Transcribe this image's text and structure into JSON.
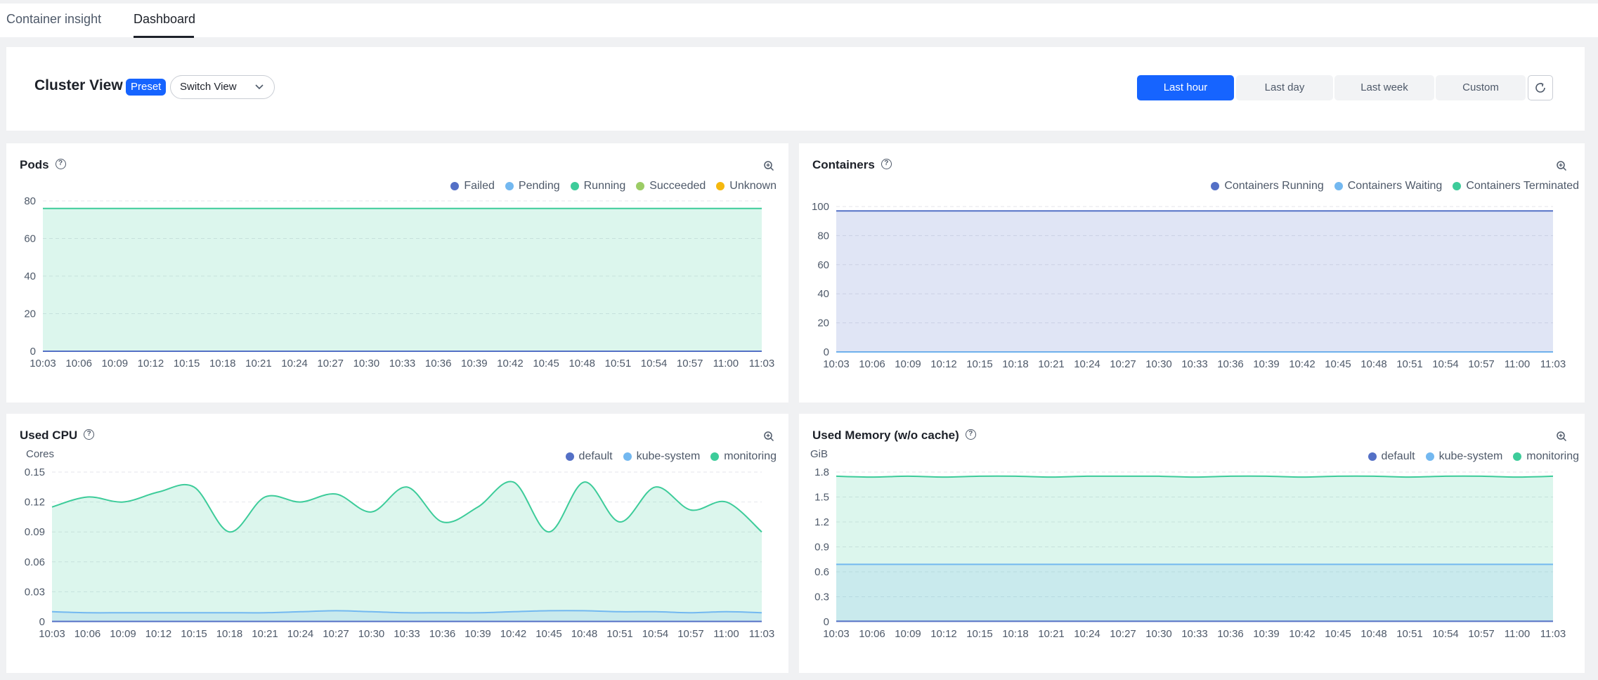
{
  "tabs": [
    {
      "label": "Container insight",
      "active": false
    },
    {
      "label": "Dashboard",
      "active": true
    }
  ],
  "header": {
    "title": "Cluster View",
    "badge": "Preset",
    "switch_view_label": "Switch View",
    "time_ranges": [
      {
        "label": "Last hour",
        "active": true
      },
      {
        "label": "Last day",
        "active": false
      },
      {
        "label": "Last week",
        "active": false
      },
      {
        "label": "Custom",
        "active": false
      }
    ]
  },
  "colors": {
    "accent": "#1664ff",
    "failed_default": "#5470c6",
    "pending_kube": "#73b8f0",
    "running_monitoring": "#3dcc9a",
    "succeeded": "#9ccc65",
    "unknown": "#f5b80e"
  },
  "panels": {
    "pods": {
      "title": "Pods",
      "legend": [
        {
          "name": "Failed",
          "color": "#5470c6"
        },
        {
          "name": "Pending",
          "color": "#73b8f0"
        },
        {
          "name": "Running",
          "color": "#3dcc9a"
        },
        {
          "name": "Succeeded",
          "color": "#9ccc65"
        },
        {
          "name": "Unknown",
          "color": "#f5b80e"
        }
      ]
    },
    "containers": {
      "title": "Containers",
      "legend": [
        {
          "name": "Containers Running",
          "color": "#5470c6"
        },
        {
          "name": "Containers Waiting",
          "color": "#73b8f0"
        },
        {
          "name": "Containers Terminated",
          "color": "#3dcc9a"
        }
      ]
    },
    "cpu": {
      "title": "Used CPU",
      "legend": [
        {
          "name": "default",
          "color": "#5470c6"
        },
        {
          "name": "kube-system",
          "color": "#73b8f0"
        },
        {
          "name": "monitoring",
          "color": "#3dcc9a"
        }
      ]
    },
    "memory": {
      "title": "Used Memory (w/o cache)",
      "legend": [
        {
          "name": "default",
          "color": "#5470c6"
        },
        {
          "name": "kube-system",
          "color": "#73b8f0"
        },
        {
          "name": "monitoring",
          "color": "#3dcc9a"
        }
      ]
    }
  },
  "chart_data": [
    {
      "type": "area",
      "name": "pods",
      "x": [
        "10:03",
        "10:06",
        "10:09",
        "10:12",
        "10:15",
        "10:18",
        "10:21",
        "10:24",
        "10:27",
        "10:30",
        "10:33",
        "10:36",
        "10:39",
        "10:42",
        "10:45",
        "10:48",
        "10:51",
        "10:54",
        "10:57",
        "11:00",
        "11:03"
      ],
      "ylim": [
        0,
        80
      ],
      "yticks": [
        0,
        20,
        40,
        60,
        80
      ],
      "yunit": "",
      "series": [
        {
          "name": "Failed",
          "color": "#5470c6",
          "values": [
            0,
            0,
            0,
            0,
            0,
            0,
            0,
            0,
            0,
            0,
            0,
            0,
            0,
            0,
            0,
            0,
            0,
            0,
            0,
            0,
            0
          ]
        },
        {
          "name": "Pending",
          "color": "#73b8f0",
          "values": [
            0,
            0,
            0,
            0,
            0,
            0,
            0,
            0,
            0,
            0,
            0,
            0,
            0,
            0,
            0,
            0,
            0,
            0,
            0,
            0,
            0
          ]
        },
        {
          "name": "Running",
          "color": "#3dcc9a",
          "values": [
            76,
            76,
            76,
            76,
            76,
            76,
            76,
            76,
            76,
            76,
            76,
            76,
            76,
            76,
            76,
            76,
            76,
            76,
            76,
            76,
            76
          ]
        },
        {
          "name": "Succeeded",
          "color": "#9ccc65",
          "values": [
            0,
            0,
            0,
            0,
            0,
            0,
            0,
            0,
            0,
            0,
            0,
            0,
            0,
            0,
            0,
            0,
            0,
            0,
            0,
            0,
            0
          ]
        },
        {
          "name": "Unknown",
          "color": "#f5b80e",
          "values": [
            0,
            0,
            0,
            0,
            0,
            0,
            0,
            0,
            0,
            0,
            0,
            0,
            0,
            0,
            0,
            0,
            0,
            0,
            0,
            0,
            0
          ]
        }
      ],
      "grid": true,
      "legend_position": "top-right"
    },
    {
      "type": "area",
      "name": "containers",
      "x": [
        "10:03",
        "10:06",
        "10:09",
        "10:12",
        "10:15",
        "10:18",
        "10:21",
        "10:24",
        "10:27",
        "10:30",
        "10:33",
        "10:36",
        "10:39",
        "10:42",
        "10:45",
        "10:48",
        "10:51",
        "10:54",
        "10:57",
        "11:00",
        "11:03"
      ],
      "ylim": [
        0,
        100
      ],
      "yticks": [
        0,
        20,
        40,
        60,
        80,
        100
      ],
      "yunit": "",
      "series": [
        {
          "name": "Containers Running",
          "color": "#5470c6",
          "values": [
            97,
            97,
            97,
            97,
            97,
            97,
            97,
            97,
            97,
            97,
            97,
            97,
            97,
            97,
            97,
            97,
            97,
            97,
            97,
            97,
            97
          ]
        },
        {
          "name": "Containers Waiting",
          "color": "#73b8f0",
          "values": [
            0,
            0,
            0,
            0,
            0,
            0,
            0,
            0,
            0,
            0,
            0,
            0,
            0,
            0,
            0,
            0,
            0,
            0,
            0,
            0,
            0
          ]
        },
        {
          "name": "Containers Terminated",
          "color": "#3dcc9a",
          "values": [
            0,
            0,
            0,
            0,
            0,
            0,
            0,
            0,
            0,
            0,
            0,
            0,
            0,
            0,
            0,
            0,
            0,
            0,
            0,
            0,
            0
          ]
        }
      ],
      "grid": true,
      "legend_position": "top-right"
    },
    {
      "type": "area",
      "name": "cpu",
      "x": [
        "10:03",
        "10:06",
        "10:09",
        "10:12",
        "10:15",
        "10:18",
        "10:21",
        "10:24",
        "10:27",
        "10:30",
        "10:33",
        "10:36",
        "10:39",
        "10:42",
        "10:45",
        "10:48",
        "10:51",
        "10:54",
        "10:57",
        "11:00",
        "11:03"
      ],
      "ylim": [
        0,
        0.15
      ],
      "yticks": [
        "0",
        "0.03",
        "0.06",
        "0.09",
        "0.12",
        "0.15"
      ],
      "yunit": "Cores",
      "series": [
        {
          "name": "default",
          "color": "#5470c6",
          "values": [
            0.0003,
            0.0003,
            0.0003,
            0.0003,
            0.0003,
            0.0003,
            0.0003,
            0.0003,
            0.0003,
            0.0003,
            0.0003,
            0.0003,
            0.0003,
            0.0003,
            0.0003,
            0.0003,
            0.0003,
            0.0003,
            0.0003,
            0.0003,
            0.0003
          ]
        },
        {
          "name": "kube-system",
          "color": "#73b8f0",
          "values": [
            0.01,
            0.009,
            0.009,
            0.009,
            0.009,
            0.009,
            0.009,
            0.01,
            0.011,
            0.01,
            0.009,
            0.009,
            0.009,
            0.01,
            0.011,
            0.011,
            0.01,
            0.01,
            0.009,
            0.01,
            0.009
          ]
        },
        {
          "name": "monitoring",
          "color": "#3dcc9a",
          "values": [
            0.115,
            0.125,
            0.12,
            0.13,
            0.135,
            0.09,
            0.125,
            0.12,
            0.128,
            0.11,
            0.135,
            0.1,
            0.115,
            0.14,
            0.09,
            0.14,
            0.1,
            0.135,
            0.112,
            0.12,
            0.09
          ]
        }
      ],
      "grid": true,
      "legend_position": "top-right"
    },
    {
      "type": "area",
      "name": "memory",
      "x": [
        "10:03",
        "10:06",
        "10:09",
        "10:12",
        "10:15",
        "10:18",
        "10:21",
        "10:24",
        "10:27",
        "10:30",
        "10:33",
        "10:36",
        "10:39",
        "10:42",
        "10:45",
        "10:48",
        "10:51",
        "10:54",
        "10:57",
        "11:00",
        "11:03"
      ],
      "ylim": [
        0,
        1.8
      ],
      "yticks": [
        "0",
        "0.3",
        "0.6",
        "0.9",
        "1.2",
        "1.5",
        "1.8"
      ],
      "yunit": "GiB",
      "series": [
        {
          "name": "default",
          "color": "#5470c6",
          "values": [
            0.005,
            0.005,
            0.005,
            0.005,
            0.005,
            0.005,
            0.005,
            0.005,
            0.005,
            0.005,
            0.005,
            0.005,
            0.005,
            0.005,
            0.005,
            0.005,
            0.005,
            0.005,
            0.005,
            0.005,
            0.005
          ]
        },
        {
          "name": "kube-system",
          "color": "#73b8f0",
          "values": [
            0.69,
            0.69,
            0.69,
            0.69,
            0.69,
            0.69,
            0.69,
            0.69,
            0.69,
            0.69,
            0.69,
            0.69,
            0.69,
            0.69,
            0.69,
            0.69,
            0.69,
            0.69,
            0.69,
            0.69,
            0.69
          ]
        },
        {
          "name": "monitoring",
          "color": "#3dcc9a",
          "values": [
            1.75,
            1.74,
            1.75,
            1.74,
            1.75,
            1.75,
            1.74,
            1.75,
            1.75,
            1.75,
            1.74,
            1.75,
            1.75,
            1.74,
            1.75,
            1.75,
            1.74,
            1.75,
            1.75,
            1.74,
            1.75
          ]
        }
      ],
      "grid": true,
      "legend_position": "top-right"
    }
  ]
}
